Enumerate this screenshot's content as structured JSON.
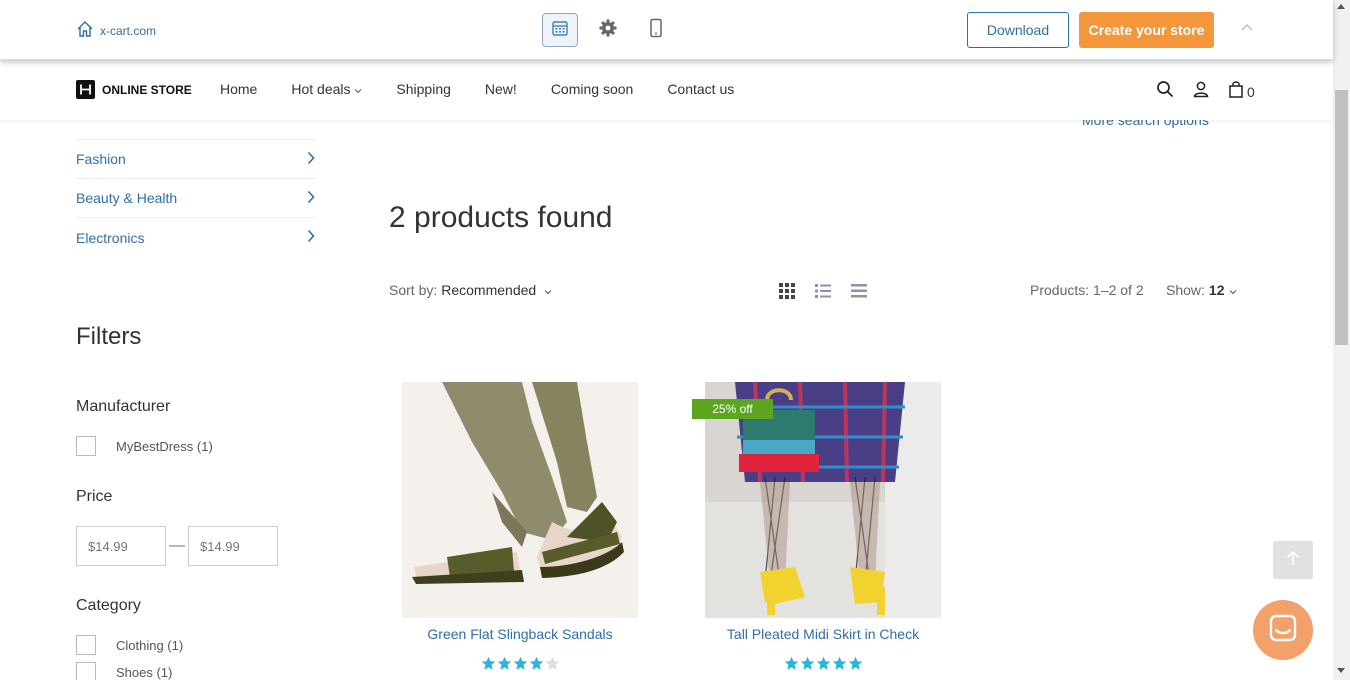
{
  "demo_bar": {
    "home_link": "x-cart.com",
    "download_label": "Download",
    "create_store_label": "Create your store"
  },
  "header": {
    "logo_text": "ONLINE STORE",
    "nav": [
      "Home",
      "Hot deals",
      "Shipping",
      "New!",
      "Coming soon",
      "Contact us"
    ],
    "cart_count": "0"
  },
  "search": {
    "more_options": "More search options"
  },
  "sidebar": {
    "categories": [
      "Fashion",
      "Beauty & Health",
      "Electronics"
    ],
    "filters_title": "Filters",
    "manufacturer": {
      "title": "Manufacturer",
      "options": [
        "MyBestDress (1)"
      ]
    },
    "price": {
      "title": "Price",
      "min_placeholder": "$14.99",
      "max_placeholder": "$14.99",
      "separator": "—"
    },
    "category": {
      "title": "Category",
      "options": [
        "Clothing (1)",
        "Shoes (1)"
      ]
    }
  },
  "main": {
    "found_title": "2 products found",
    "sort_label": "Sort by:",
    "sort_value": "Recommended",
    "pager_info": "Products: 1–2 of 2",
    "show_label": "Show:",
    "show_value": "12",
    "products": [
      {
        "name": "Green Flat Slingback Sandals",
        "rating": 4,
        "badge": ""
      },
      {
        "name": "Tall Pleated Midi Skirt in Check",
        "rating": 4.8,
        "badge": "25% off"
      }
    ]
  },
  "colors": {
    "link": "#2f6fa7",
    "accent": "#f4963a",
    "badge": "#5ba51f",
    "star": "#29b6d6"
  }
}
